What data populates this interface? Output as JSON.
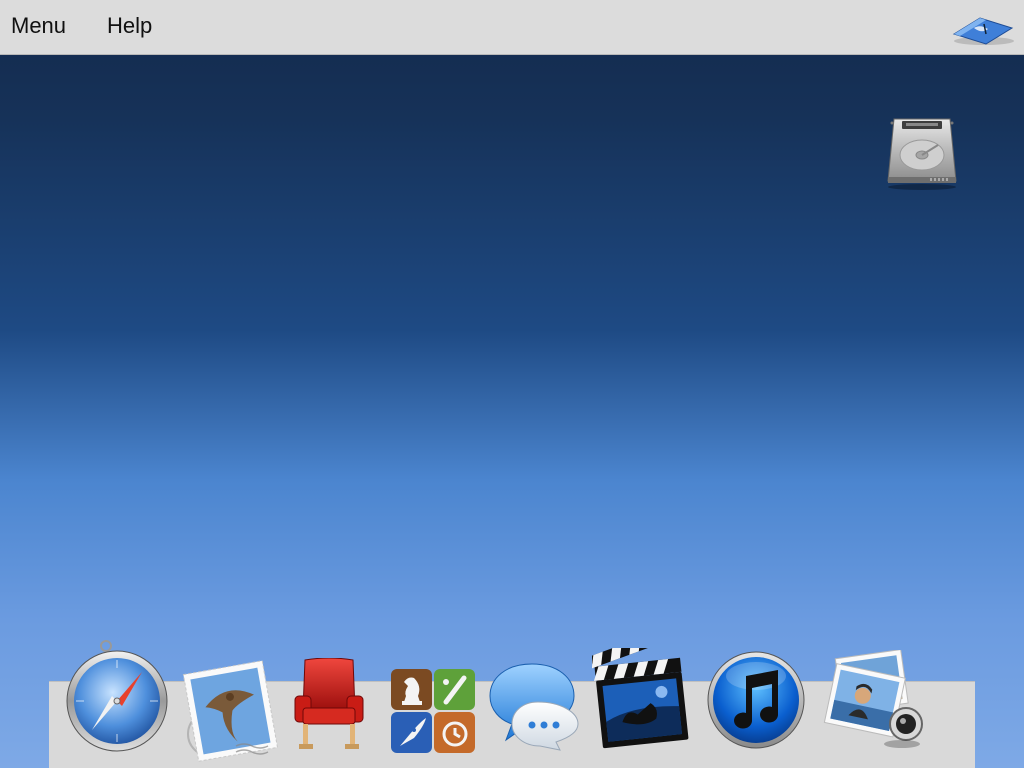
{
  "menubar": {
    "items": [
      {
        "label": "Menu"
      },
      {
        "label": "Help"
      }
    ],
    "right_icon": "finder-icon"
  },
  "desktop": {
    "icons": [
      {
        "icon": "hard-drive-icon"
      }
    ]
  },
  "dock": {
    "items": [
      {
        "icon": "safari-compass-icon"
      },
      {
        "icon": "mail-stamp-icon"
      },
      {
        "icon": "red-chair-icon"
      },
      {
        "icon": "game-center-icon"
      },
      {
        "icon": "messages-bubble-icon"
      },
      {
        "icon": "imovie-clapper-icon"
      },
      {
        "icon": "itunes-note-icon"
      },
      {
        "icon": "preview-photos-icon"
      }
    ]
  },
  "colors": {
    "menubar": "#dcdcdc",
    "desktop_top": "#13294b",
    "desktop_bottom": "#7ea9e6",
    "dock_shelf": "#d9d9d9"
  }
}
